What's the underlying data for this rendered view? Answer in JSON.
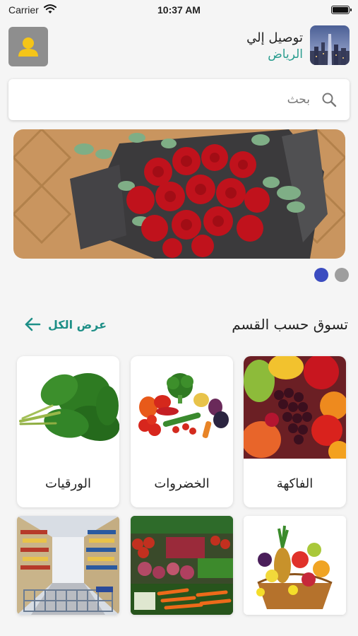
{
  "status_bar": {
    "carrier": "Carrier",
    "time": "10:37 AM"
  },
  "header": {
    "delivery_label": "توصيل إلي",
    "city": "الرياض"
  },
  "search": {
    "placeholder": "بحث"
  },
  "banner": {
    "slide_count": 2,
    "active_slide": 1
  },
  "section": {
    "title": "تسوق حسب القسم",
    "view_all": "عرض الكل"
  },
  "categories": [
    {
      "label": "الفاكهة",
      "icon": "fruits-image"
    },
    {
      "label": "الخضروات",
      "icon": "vegetables-image"
    },
    {
      "label": "الورقيات",
      "icon": "leafy-greens-image"
    }
  ],
  "second_row": [
    {
      "icon": "fruit-basket-image"
    },
    {
      "icon": "market-produce-image"
    },
    {
      "icon": "supermarket-aisle-image"
    }
  ],
  "colors": {
    "accent_teal": "#1e8f87",
    "dot_active": "#3b4cc0",
    "dot_inactive": "#9e9e9e"
  }
}
